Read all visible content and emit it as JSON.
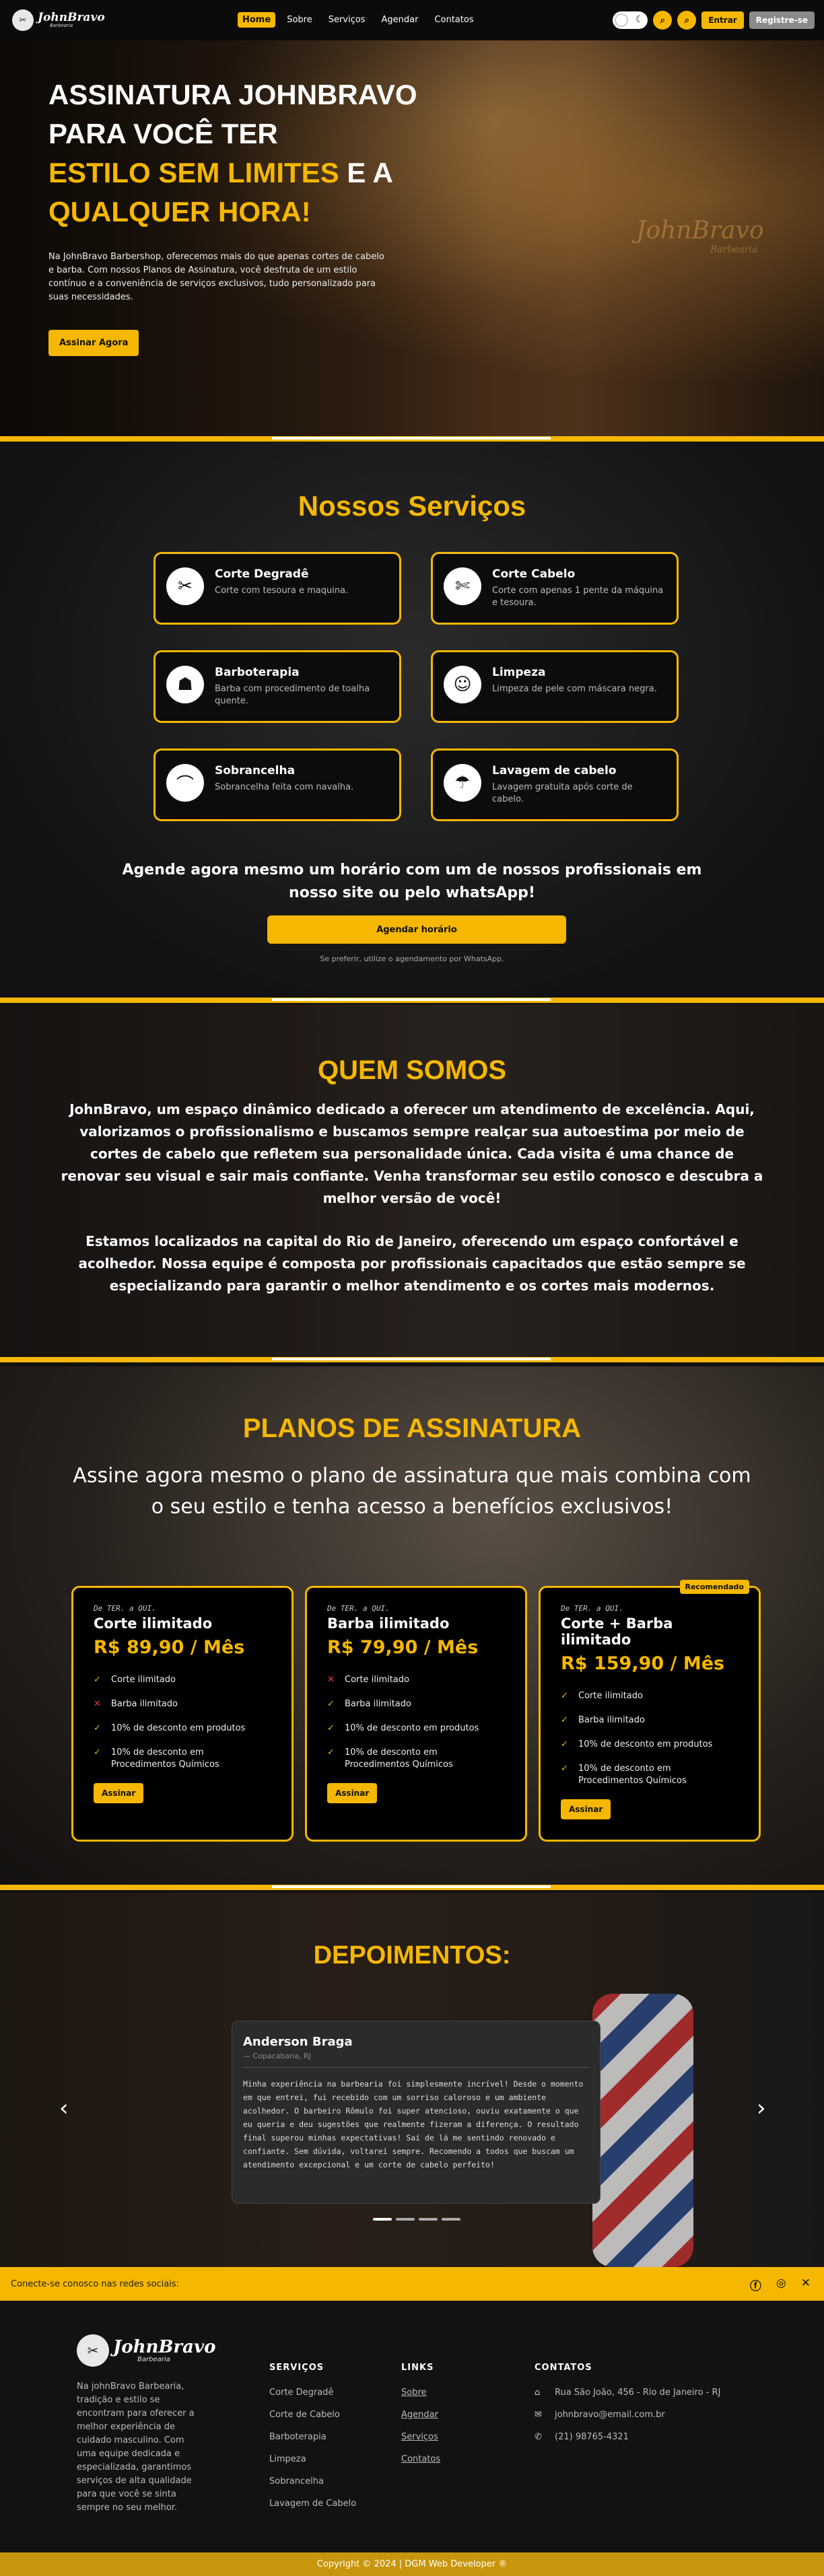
{
  "header": {
    "logo_text": "JohnBravo",
    "logo_sub": "Barbearia",
    "nav": [
      "Home",
      "Sobre",
      "Serviços",
      "Agendar",
      "Contatos"
    ],
    "entrar": "Entrar",
    "registre": "Registre-se"
  },
  "hero": {
    "title_line1": "ASSINATURA JOHNBRAVO",
    "title_line2": "PARA VOCÊ TER",
    "title_hl1": "ESTILO SEM LIMITES",
    "title_mid": " E A",
    "title_hl2": "QUALQUER HORA!",
    "text": "Na JohnBravo Barbershop, oferecemos mais do que apenas cortes de cabelo e barba. Com nossos Planos de Assinatura, você desfruta de um estilo contínuo e a conveniência de serviços exclusivos, tudo personalizado para suas necessidades.",
    "button": "Assinar Agora",
    "watermark": "JohnBravo",
    "watermark_sub": "Barbearia"
  },
  "services": {
    "title": "Nossos Serviços",
    "items": [
      {
        "name": "Corte Degradê",
        "desc": "Corte com tesoura e maquina."
      },
      {
        "name": "Corte Cabelo",
        "desc": "Corte com apenas 1 pente da máquina e tesoura."
      },
      {
        "name": "Barboterapia",
        "desc": "Barba com procedimento de toalha quente."
      },
      {
        "name": "Limpeza",
        "desc": "Limpeza de pele com máscara negra."
      },
      {
        "name": "Sobrancelha",
        "desc": "Sobrancelha feita com navalha."
      },
      {
        "name": "Lavagem de cabelo",
        "desc": "Lavagem gratuita após corte de cabelo."
      }
    ],
    "agende_title": "Agende agora mesmo um horário com um de nossos profissionais em nosso site ou pelo whatsApp!",
    "agende_button": "Agendar horário",
    "agende_note": "Se preferir, utilize o agendamento por WhatsApp."
  },
  "about": {
    "title": "QUEM SOMOS",
    "p1": "JohnBravo, um espaço dinâmico dedicado a oferecer um atendimento de excelência. Aqui, valorizamos o profissionalismo e buscamos sempre realçar sua autoestima por meio de cortes de cabelo que refletem sua personalidade única. Cada visita é uma chance de renovar seu visual e sair mais confiante. Venha transformar seu estilo conosco e descubra a melhor versão de você!",
    "p2": "Estamos localizados na capital do Rio de Janeiro, oferecendo um espaço confortável e acolhedor. Nossa equipe é composta por profissionais capacitados que estão sempre se especializando para garantir o melhor atendimento e os cortes mais modernos."
  },
  "plans": {
    "title": "PLANOS DE ASSINATURA",
    "subtitle": "Assine agora mesmo o plano de assinatura que mais combina com o seu estilo e tenha acesso a benefícios exclusivos!",
    "badge": "Recomendado",
    "items": [
      {
        "pre": "De TER. a QUI.",
        "name": "Corte ilimitado",
        "price": "R$ 89,90 / Mês",
        "button": "Assinar",
        "features": [
          {
            "text": "Corte ilimitado",
            "ok": true
          },
          {
            "text": "Barba ilimitado",
            "ok": false
          },
          {
            "text": "10% de desconto em produtos",
            "ok": true
          },
          {
            "text": "10% de desconto em Procedimentos Químicos",
            "ok": true
          }
        ]
      },
      {
        "pre": "De TER. a QUI.",
        "name": "Barba ilimitado",
        "price": "R$ 79,90 / Mês",
        "button": "Assinar",
        "features": [
          {
            "text": "Corte ilimitado",
            "ok": false
          },
          {
            "text": "Barba ilimitado",
            "ok": true
          },
          {
            "text": "10% de desconto em produtos",
            "ok": true
          },
          {
            "text": "10% de desconto em Procedimentos Químicos",
            "ok": true
          }
        ]
      },
      {
        "pre": "De TER. a QUI.",
        "name": "Corte + Barba ilimitado",
        "price": "R$ 159,90 / Mês",
        "button": "Assinar",
        "features": [
          {
            "text": "Corte ilimitado",
            "ok": true
          },
          {
            "text": "Barba ilimitado",
            "ok": true
          },
          {
            "text": "10% de desconto em produtos",
            "ok": true
          },
          {
            "text": "10% de desconto em Procedimentos Químicos",
            "ok": true
          }
        ]
      }
    ]
  },
  "testimonials": {
    "title": "DEPOIMENTOS:",
    "name": "Anderson Braga",
    "location": "— Copacabana, RJ",
    "text": "Minha experiência na barbearia foi simplesmente incrível! Desde o momento em que entrei, fui recebido com um sorriso caloroso e um ambiente acolhedor. O barbeiro Rômulo foi super atencioso, ouviu exatamente o que eu queria e deu sugestões que realmente fizeram a diferença. O resultado final superou minhas expectativas! Saí de lá me sentindo renovado e confiante. Sem dúvida, voltarei sempre. Recomendo a todos que buscam um atendimento excepcional e um corte de cabelo perfeito!",
    "prev": "‹",
    "next": "›"
  },
  "social": {
    "text": "Conecte-se conosco nas redes sociais:",
    "icons": [
      "facebook-icon",
      "instagram-icon",
      "x-icon"
    ]
  },
  "footer": {
    "logo_text": "JohnBravo",
    "logo_sub": "Barbearia",
    "about": "Na johnBravo Barbearia, tradição e estilo se encontram para oferecer a melhor experiência de cuidado masculino. Com uma equipe dedicada e especializada, garantimos serviços de alta qualidade para que você se sinta sempre no seu melhor.",
    "services_head": "SERVIÇOS",
    "services": [
      "Corte Degradê",
      "Corte de Cabelo",
      "Barboterapia",
      "Limpeza",
      "Sobrancelha",
      "Lavagem de Cabelo"
    ],
    "links_head": "LINKS",
    "links": [
      "Sobre",
      "Agendar",
      "Serviços",
      "Contatos"
    ],
    "contacts_head": "CONTATOS",
    "address": "Rua São João, 456 - Rio de Janeiro - RJ",
    "email": "johnbravo@email.com.br",
    "phone": "(21) 98765-4321",
    "copyright": "Copyright © 2024 | DGM Web Developer ®"
  },
  "colors": {
    "accent": "#f5b700",
    "dark": "#111111"
  }
}
